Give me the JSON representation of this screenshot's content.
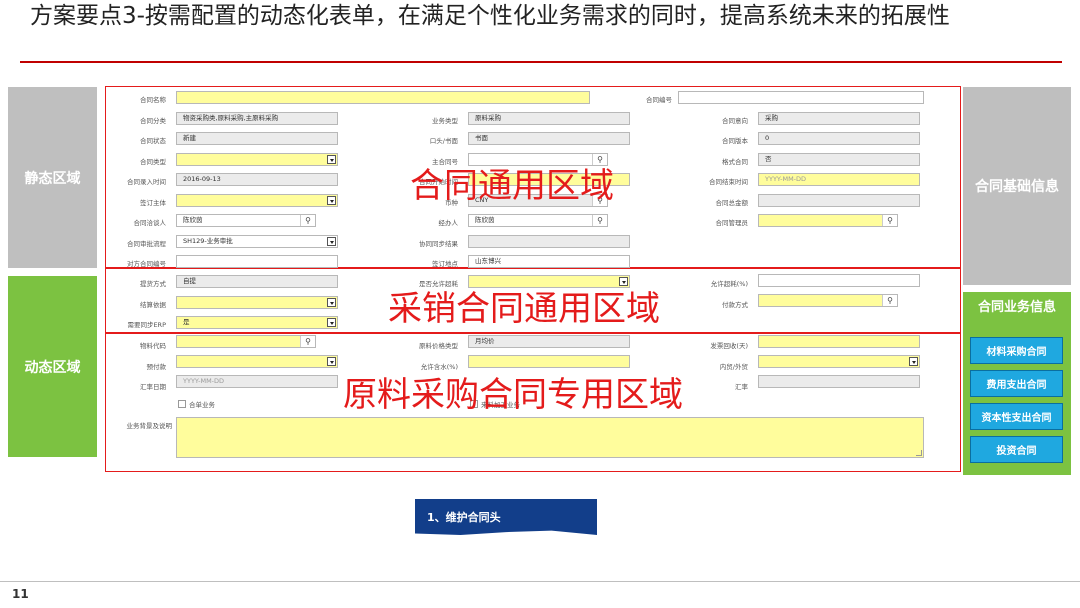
{
  "slide": {
    "title": "方案要点3-按需配置的动态化表单，在满足个性化业务需求的同时，提高系统未来的拓展性",
    "page_number": "11"
  },
  "sidebar_left": {
    "static_label": "静态区域",
    "dynamic_label": "动态区域"
  },
  "sidebar_right": {
    "basic_label": "合同基础信息",
    "business_label": "合同业务信息",
    "buttons": [
      "材料采购合同",
      "费用支出合同",
      "资本性支出合同",
      "投资合同"
    ]
  },
  "regions": {
    "general": "合同通用区域",
    "purchase_sale": "采销合同通用区域",
    "raw_material": "原料采购合同专用区域"
  },
  "flow_step": "1、维护合同头",
  "form": {
    "contract_name": {
      "label": "合同名称",
      "value": ""
    },
    "contract_no": {
      "label": "合同编号",
      "value": ""
    },
    "contract_category": {
      "label": "合同分类",
      "value": "物资采购类,原料采购,主原料采购"
    },
    "business_type": {
      "label": "业务类型",
      "value": "原料采购"
    },
    "contract_direction": {
      "label": "合同意向",
      "value": "采购"
    },
    "contract_status": {
      "label": "合同状态",
      "value": "新建"
    },
    "oral_written": {
      "label": "口头/书面",
      "value": "书面"
    },
    "contract_version": {
      "label": "合同版本",
      "value": "0"
    },
    "contract_type": {
      "label": "合同类型",
      "value": ""
    },
    "master_contract_no": {
      "label": "主合同号",
      "value": ""
    },
    "format_contract": {
      "label": "格式合同",
      "value": "否"
    },
    "entry_time": {
      "label": "合同录入时间",
      "value": "2016-09-13"
    },
    "start_time": {
      "label": "合同开始时间",
      "value": ""
    },
    "end_time": {
      "label": "合同结束时间",
      "value": "YYYY-MM-DD"
    },
    "signing_entity": {
      "label": "签订主体",
      "value": ""
    },
    "currency": {
      "label": "币种",
      "value": "CNY"
    },
    "total_amount": {
      "label": "合同总金额",
      "value": ""
    },
    "negotiator": {
      "label": "合同洽谈人",
      "value": "陈欣茵"
    },
    "handler": {
      "label": "经办人",
      "value": "陈欣茵"
    },
    "manager": {
      "label": "合同管理员",
      "value": ""
    },
    "approval_flow": {
      "label": "合同审批流程",
      "value": "SH129-业务审批"
    },
    "sync_result": {
      "label": "协同同步结果",
      "value": ""
    },
    "counterparty_no": {
      "label": "对方合同编号",
      "value": ""
    },
    "signing_place": {
      "label": "签订地点",
      "value": "山东博兴"
    },
    "delivery_method": {
      "label": "提货方式",
      "value": "自提"
    },
    "allow_overdraft": {
      "label": "是否允许超耗",
      "value": ""
    },
    "allowed_overdraft_pct": {
      "label": "允许超耗(%)",
      "value": ""
    },
    "settlement_basis": {
      "label": "结算依据",
      "value": ""
    },
    "payment_method": {
      "label": "付款方式",
      "value": ""
    },
    "need_sync_erp": {
      "label": "需要同步ERP",
      "value": "是"
    },
    "material_code": {
      "label": "物料代码",
      "value": ""
    },
    "price_type": {
      "label": "原料价格类型",
      "value": "月均价"
    },
    "invoice_collection": {
      "label": "发票回收(天)",
      "value": ""
    },
    "prepayment": {
      "label": "预付款",
      "value": ""
    },
    "allowed_moisture": {
      "label": "允许含水(%)",
      "value": ""
    },
    "domestic_foreign": {
      "label": "内贸/外贸",
      "value": ""
    },
    "exchange_date": {
      "label": "汇率日期",
      "value": "YYYY-MM-DD"
    },
    "exchange_rate": {
      "label": "汇率",
      "value": ""
    },
    "combined_business": {
      "label": "合单业务"
    },
    "processing_material": {
      "label": "来料加工业务"
    },
    "business_background": {
      "label": "业务背景及说明",
      "value": ""
    }
  },
  "colors": {
    "accent_red": "#e41b1b",
    "static_gray": "#bfbfbf",
    "dynamic_green": "#7cc241",
    "button_blue": "#1fa8e0",
    "flow_navy": "#123e8a",
    "required_yellow": "#fffd9c",
    "readonly_gray": "#ebebeb"
  }
}
